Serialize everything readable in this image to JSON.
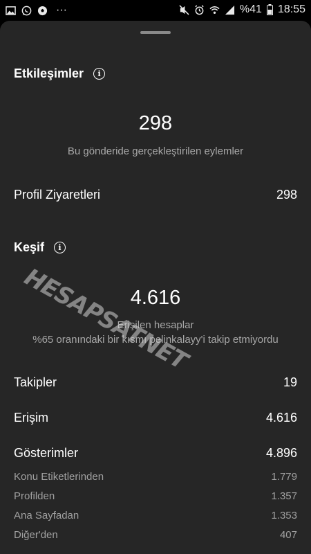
{
  "status_bar": {
    "left_icons": [
      "gallery-icon",
      "whatsapp-icon",
      "soccer-ball-icon",
      "more-icon"
    ],
    "right_icons": [
      "mute-icon",
      "alarm-icon",
      "wifi-icon",
      "signal-icon"
    ],
    "more": "···",
    "battery": "%41",
    "time": "18:55"
  },
  "engagement": {
    "title": "Etkileşimler",
    "total": "298",
    "total_caption": "Bu gönderide gerçekleştirilen eylemler",
    "profile_visits_label": "Profil Ziyaretleri",
    "profile_visits_value": "298"
  },
  "discovery": {
    "title": "Keşif",
    "reach": "4.616",
    "reach_caption": "Erişilen hesaplar",
    "follow_note": "%65 oranındaki bir kısmı pelinkalayy'i takip etmiyordu",
    "rows": [
      {
        "label": "Takipler",
        "value": "19"
      },
      {
        "label": "Erişim",
        "value": "4.616"
      },
      {
        "label": "Gösterimler",
        "value": "4.896"
      }
    ],
    "impression_sources": [
      {
        "label": "Konu Etiketlerinden",
        "value": "1.779"
      },
      {
        "label": "Profilden",
        "value": "1.357"
      },
      {
        "label": "Ana Sayfadan",
        "value": "1.353"
      },
      {
        "label": "Diğer'den",
        "value": "407"
      }
    ]
  },
  "info_glyph": "i",
  "watermark": "HESAPSATNET"
}
